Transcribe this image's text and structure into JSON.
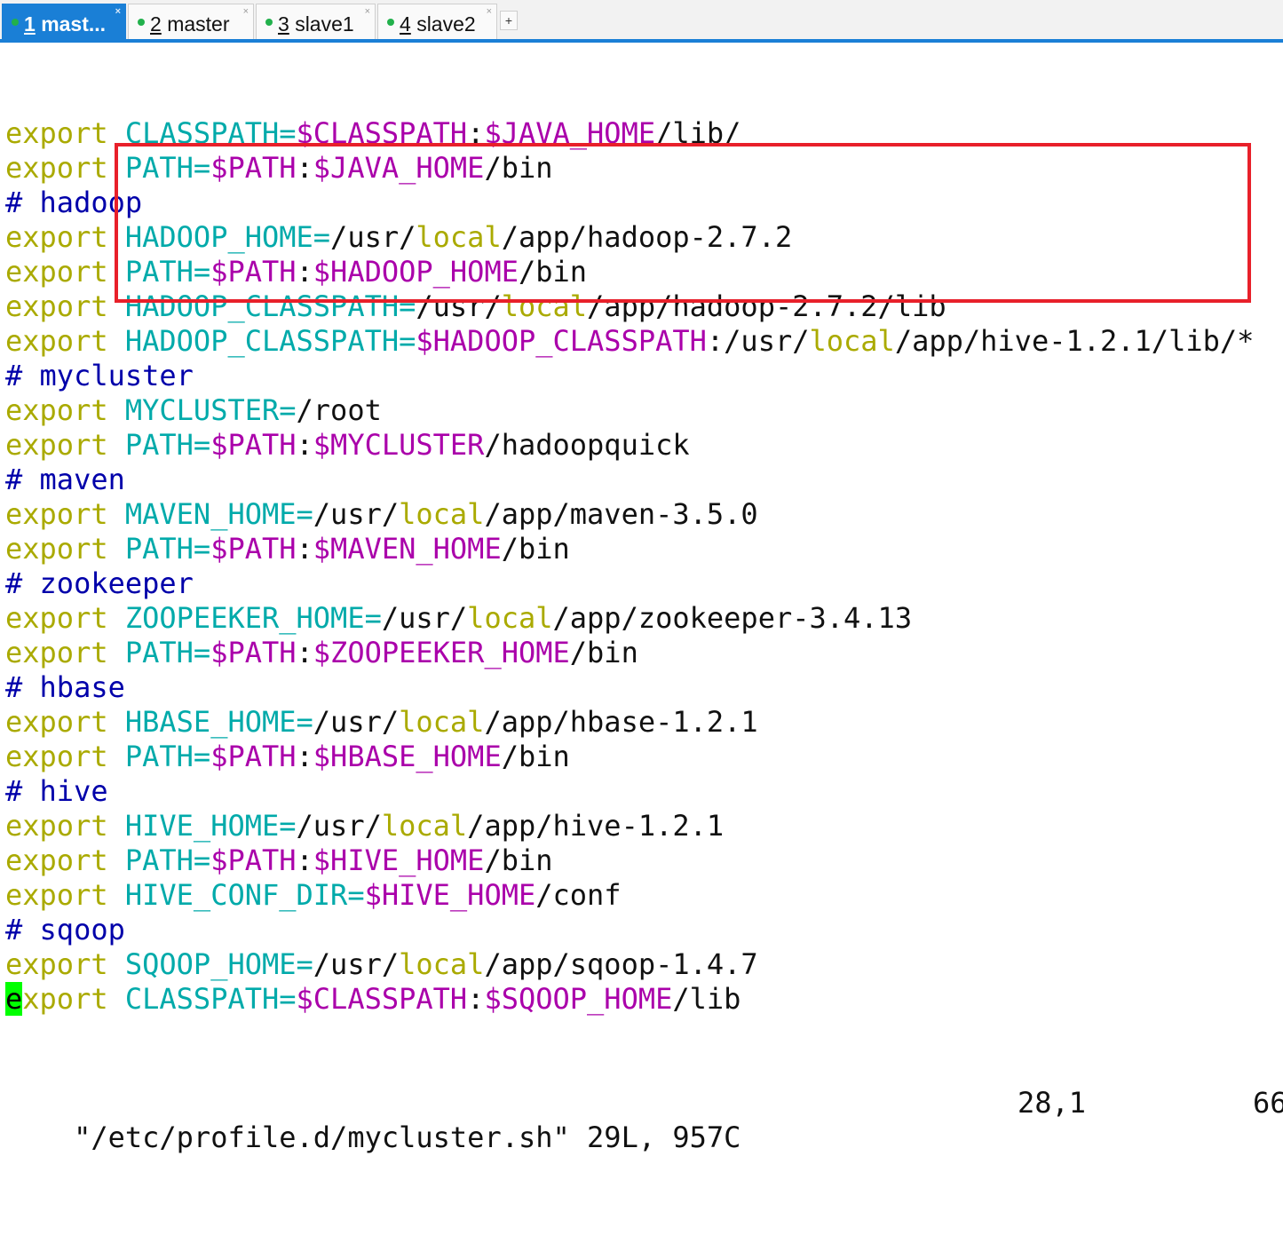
{
  "tabs": [
    {
      "number": "1",
      "name": "mast...",
      "active": true
    },
    {
      "number": "2",
      "name": "master",
      "active": false
    },
    {
      "number": "3",
      "name": "slave1",
      "active": false
    },
    {
      "number": "4",
      "name": "slave2",
      "active": false
    }
  ],
  "tab_add_label": "+",
  "tab_close_label": "×",
  "colors": {
    "keyword": "#aaaa00",
    "variable": "#00aaaa",
    "dollar_ref": "#aa00aa",
    "comment": "#0000aa",
    "cursor": "#00ff00",
    "highlight_box": "#e8202a",
    "tab_active": "#1a7fd6",
    "status_dot": "#22b14c"
  },
  "editor": {
    "lines": [
      [
        [
          "export",
          "kw"
        ],
        [
          " ",
          ""
        ],
        [
          "CLASSPATH=",
          "var"
        ],
        [
          "$CLASSPATH",
          "dollar"
        ],
        [
          ":",
          ""
        ],
        [
          "$JAVA_HOME",
          "dollar"
        ],
        [
          "/lib/",
          ""
        ]
      ],
      [
        [
          "export",
          "kw"
        ],
        [
          " ",
          ""
        ],
        [
          "PATH=",
          "var"
        ],
        [
          "$PATH",
          "dollar"
        ],
        [
          ":",
          ""
        ],
        [
          "$JAVA_HOME",
          "dollar"
        ],
        [
          "/bin",
          ""
        ]
      ],
      [
        [
          "# hadoop",
          "cmt"
        ]
      ],
      [
        [
          "export",
          "kw"
        ],
        [
          " ",
          ""
        ],
        [
          "HADOOP_HOME=",
          "var"
        ],
        [
          "/usr/",
          ""
        ],
        [
          "local",
          "local"
        ],
        [
          "/app/hadoop-2.7.2",
          ""
        ]
      ],
      [
        [
          "export",
          "kw"
        ],
        [
          " ",
          ""
        ],
        [
          "PATH=",
          "var"
        ],
        [
          "$PATH",
          "dollar"
        ],
        [
          ":",
          ""
        ],
        [
          "$HADOOP_HOME",
          "dollar"
        ],
        [
          "/bin",
          ""
        ]
      ],
      [
        [
          "export",
          "kw"
        ],
        [
          " ",
          ""
        ],
        [
          "HADOOP_CLASSPATH=",
          "var"
        ],
        [
          "/usr/",
          ""
        ],
        [
          "local",
          "local"
        ],
        [
          "/app/hadoop-2.7.2/lib",
          ""
        ]
      ],
      [
        [
          "export",
          "kw"
        ],
        [
          " ",
          ""
        ],
        [
          "HADOOP_CLASSPATH=",
          "var"
        ],
        [
          "$HADOOP_CLASSPATH",
          "dollar"
        ],
        [
          ":/usr/",
          ""
        ],
        [
          "local",
          "local"
        ],
        [
          "/app/hive-1.2.1/lib/*",
          ""
        ]
      ],
      [
        [
          "# mycluster",
          "cmt"
        ]
      ],
      [
        [
          "export",
          "kw"
        ],
        [
          " ",
          ""
        ],
        [
          "MYCLUSTER=",
          "var"
        ],
        [
          "/root",
          ""
        ]
      ],
      [
        [
          "export",
          "kw"
        ],
        [
          " ",
          ""
        ],
        [
          "PATH=",
          "var"
        ],
        [
          "$PATH",
          "dollar"
        ],
        [
          ":",
          ""
        ],
        [
          "$MYCLUSTER",
          "dollar"
        ],
        [
          "/hadoopquick",
          ""
        ]
      ],
      [
        [
          "# maven",
          "cmt"
        ]
      ],
      [
        [
          "export",
          "kw"
        ],
        [
          " ",
          ""
        ],
        [
          "MAVEN_HOME=",
          "var"
        ],
        [
          "/usr/",
          ""
        ],
        [
          "local",
          "local"
        ],
        [
          "/app/maven-3.5.0",
          ""
        ]
      ],
      [
        [
          "export",
          "kw"
        ],
        [
          " ",
          ""
        ],
        [
          "PATH=",
          "var"
        ],
        [
          "$PATH",
          "dollar"
        ],
        [
          ":",
          ""
        ],
        [
          "$MAVEN_HOME",
          "dollar"
        ],
        [
          "/bin",
          ""
        ]
      ],
      [
        [
          "# zookeeper",
          "cmt"
        ]
      ],
      [
        [
          "export",
          "kw"
        ],
        [
          " ",
          ""
        ],
        [
          "ZOOPEEKER_HOME=",
          "var"
        ],
        [
          "/usr/",
          ""
        ],
        [
          "local",
          "local"
        ],
        [
          "/app/zookeeper-3.4.13",
          ""
        ]
      ],
      [
        [
          "export",
          "kw"
        ],
        [
          " ",
          ""
        ],
        [
          "PATH=",
          "var"
        ],
        [
          "$PATH",
          "dollar"
        ],
        [
          ":",
          ""
        ],
        [
          "$ZOOPEEKER_HOME",
          "dollar"
        ],
        [
          "/bin",
          ""
        ]
      ],
      [
        [
          "# hbase",
          "cmt"
        ]
      ],
      [
        [
          "export",
          "kw"
        ],
        [
          " ",
          ""
        ],
        [
          "HBASE_HOME=",
          "var"
        ],
        [
          "/usr/",
          ""
        ],
        [
          "local",
          "local"
        ],
        [
          "/app/hbase-1.2.1",
          ""
        ]
      ],
      [
        [
          "export",
          "kw"
        ],
        [
          " ",
          ""
        ],
        [
          "PATH=",
          "var"
        ],
        [
          "$PATH",
          "dollar"
        ],
        [
          ":",
          ""
        ],
        [
          "$HBASE_HOME",
          "dollar"
        ],
        [
          "/bin",
          ""
        ]
      ],
      [
        [
          "# hive",
          "cmt"
        ]
      ],
      [
        [
          "export",
          "kw"
        ],
        [
          " ",
          ""
        ],
        [
          "HIVE_HOME=",
          "var"
        ],
        [
          "/usr/",
          ""
        ],
        [
          "local",
          "local"
        ],
        [
          "/app/hive-1.2.1",
          ""
        ]
      ],
      [
        [
          "export",
          "kw"
        ],
        [
          " ",
          ""
        ],
        [
          "PATH=",
          "var"
        ],
        [
          "$PATH",
          "dollar"
        ],
        [
          ":",
          ""
        ],
        [
          "$HIVE_HOME",
          "dollar"
        ],
        [
          "/bin",
          ""
        ]
      ],
      [
        [
          "export",
          "kw"
        ],
        [
          " ",
          ""
        ],
        [
          "HIVE_CONF_DIR=",
          "var"
        ],
        [
          "$HIVE_HOME",
          "dollar"
        ],
        [
          "/conf",
          ""
        ]
      ],
      [
        [
          "# sqoop",
          "cmt"
        ]
      ],
      [
        [
          "export",
          "kw"
        ],
        [
          " ",
          ""
        ],
        [
          "SQOOP_HOME=",
          "var"
        ],
        [
          "/usr/",
          ""
        ],
        [
          "local",
          "local"
        ],
        [
          "/app/sqoop-1.4.7",
          ""
        ]
      ],
      [
        [
          "e",
          "cursor"
        ],
        [
          "xport",
          "kw"
        ],
        [
          " ",
          ""
        ],
        [
          "CLASSPATH=",
          "var"
        ],
        [
          "$CLASSPATH",
          "dollar"
        ],
        [
          ":",
          ""
        ],
        [
          "$SQOOP_HOME",
          "dollar"
        ],
        [
          "/lib",
          ""
        ]
      ]
    ]
  },
  "status_bar": {
    "file_info": "\"/etc/profile.d/mycluster.sh\" 29L, 957C",
    "cursor_position": "28,1",
    "scroll_percent": "66"
  }
}
